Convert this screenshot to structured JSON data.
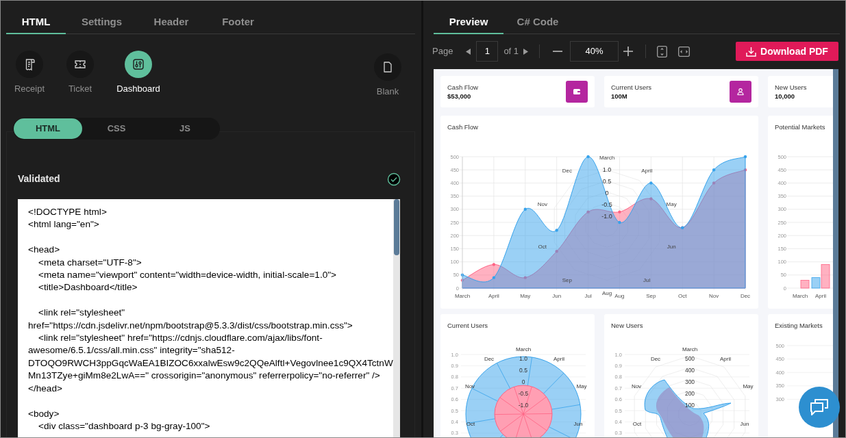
{
  "left_tabs": [
    {
      "label": "HTML",
      "selected": true
    },
    {
      "label": "Settings",
      "selected": false
    },
    {
      "label": "Header",
      "selected": false
    },
    {
      "label": "Footer",
      "selected": false
    }
  ],
  "templates": [
    {
      "label": "Receipt",
      "kind": "receipt",
      "selected": false
    },
    {
      "label": "Ticket",
      "kind": "ticket",
      "selected": false
    },
    {
      "label": "Dashboard",
      "kind": "dashboard",
      "selected": true
    },
    {
      "label": "Blank",
      "kind": "blank",
      "selected": false
    }
  ],
  "code_tabs": [
    {
      "label": "HTML",
      "selected": true
    },
    {
      "label": "CSS",
      "selected": false
    },
    {
      "label": "JS",
      "selected": false
    }
  ],
  "validation": {
    "label": "Validated",
    "valid": true
  },
  "code": "<!DOCTYPE html>\n<html lang=\"en\">\n\n<head>\n    <meta charset=\"UTF-8\">\n    <meta name=\"viewport\" content=\"width=device-width, initial-scale=1.0\">\n    <title>Dashboard</title>\n\n    <link rel=\"stylesheet\" href=\"https://cdn.jsdelivr.net/npm/bootstrap@5.3.3/dist/css/bootstrap.min.css\">\n    <link rel=\"stylesheet\" href=\"https://cdnjs.cloudflare.com/ajax/libs/font-awesome/6.5.1/css/all.min.css\" integrity=\"sha512-DTOQO9RWCH3ppGqcWaEA1BIZOC6xxalwEsw9c2QQeAlftl+Vegovlnee1c9QX4TctnWMn13TZye+giMm8e2LwA==\" crossorigin=\"anonymous\" referrerpolicy=\"no-referrer\" />\n</head>\n\n<body>\n    <div class=\"dashboard p-3 bg-gray-100\">",
  "right_tabs": [
    {
      "label": "Preview",
      "selected": true
    },
    {
      "label": "C# Code",
      "selected": false
    }
  ],
  "toolbar": {
    "page_label": "Page",
    "page": "1",
    "page_count": "of 1",
    "zoom": "40%",
    "download": "Download PDF"
  },
  "preview": {
    "stats": [
      {
        "label": "Cash Flow",
        "value": "$53,000"
      },
      {
        "label": "Current Users",
        "value": "100M"
      },
      {
        "label": "New Users",
        "value": "10,000"
      }
    ],
    "cash_flow": {
      "title": "Cash Flow",
      "overlay_labels": [
        "March",
        "April",
        "May",
        "Jun",
        "Jul",
        "Aug",
        "Sep",
        "Oct",
        "Nov",
        "Dec"
      ],
      "overlay_ticks": [
        "1.0",
        "0.5",
        "0",
        "-0.5",
        "-1.0"
      ],
      "chart_data": {
        "type": "area",
        "grid": true,
        "categories": [
          "March",
          "April",
          "May",
          "Jun",
          "Jul",
          "Aug",
          "Sep",
          "Oct",
          "Nov",
          "Dec"
        ],
        "yticks": [
          0,
          50,
          100,
          150,
          200,
          250,
          300,
          350,
          400,
          450,
          500
        ],
        "ylim": [
          0,
          500
        ],
        "series": [
          {
            "color": "#ff6384",
            "values": [
              30,
              90,
              40,
              140,
              290,
              290,
              340,
              230,
              400,
              450
            ]
          },
          {
            "color": "#36a2eb",
            "values": [
              50,
              40,
              300,
              220,
              500,
              250,
              400,
              230,
              450,
              500
            ]
          }
        ]
      }
    },
    "potential_markets": {
      "title": "Potential Markets",
      "chart_data": {
        "type": "bar",
        "grid": true,
        "categories": [
          "March",
          "April"
        ],
        "yticks": [
          0,
          50,
          100,
          150,
          200,
          250,
          300,
          350,
          400,
          450,
          500
        ],
        "ylim": [
          0,
          500
        ],
        "series": [
          {
            "color": "#36a2eb",
            "values": [
              0,
              40
            ]
          },
          {
            "color": "#ff6384",
            "values": [
              30,
              90
            ]
          }
        ]
      }
    },
    "current_users": {
      "title": "Current Users",
      "y_ticks": [
        "1.0",
        "0.9",
        "0.8",
        "0.7",
        "0.6",
        "0.5",
        "0.4",
        "0.3"
      ],
      "angle_labels": [
        "March",
        "April",
        "May",
        "Jun",
        "Oct",
        "Nov",
        "Dec"
      ],
      "radial_ticks": [
        "1.0",
        "0.5",
        "0",
        "-0.5",
        "-1.0"
      ]
    },
    "new_users": {
      "title": "New Users",
      "y_ticks": [
        "1.0",
        "0.9",
        "0.8",
        "0.7",
        "0.6",
        "0.5",
        "0.4",
        "0.3"
      ],
      "angle_labels": [
        "March",
        "April",
        "May",
        "Jun",
        "Oct",
        "Nov",
        "Dec"
      ],
      "radial_ticks": [
        "500",
        "400",
        "300",
        "200",
        "100"
      ]
    },
    "existing_markets": {
      "title": "Existing Markets",
      "y_ticks": [
        "500",
        "450",
        "400",
        "350",
        "300"
      ]
    }
  }
}
